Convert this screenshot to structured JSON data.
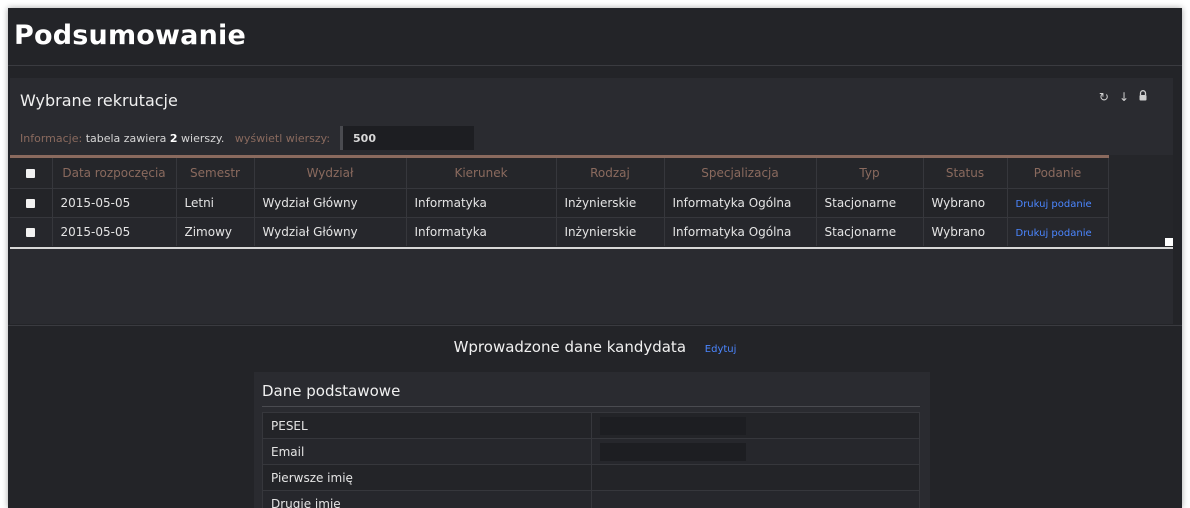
{
  "page": {
    "title": "Podsumowanie"
  },
  "recruitments": {
    "heading": "Wybrane rekrutacje",
    "toolbar_icons": [
      "refresh-icon",
      "download-icon",
      "lock-icon"
    ],
    "info": {
      "label": "Informacje:",
      "text_before": "tabela zawiera",
      "count": "2",
      "text_after": "wierszy.",
      "rows_label": "wyświetl wierszy:",
      "rows_value": "500"
    },
    "columns": [
      "Data rozpoczęcia",
      "Semestr",
      "Wydział",
      "Kierunek",
      "Rodzaj",
      "Specjalizacja",
      "Typ",
      "Status",
      "Podanie"
    ],
    "rows": [
      {
        "date": "2015-05-05",
        "semester": "Letni",
        "faculty": "Wydział Główny",
        "field": "Informatyka",
        "kind": "Inżynierskie",
        "specialization": "Informatyka Ogólna",
        "type": "Stacjonarne",
        "status": "Wybrano",
        "action": "Drukuj podanie"
      },
      {
        "date": "2015-05-05",
        "semester": "Zimowy",
        "faculty": "Wydział Główny",
        "field": "Informatyka",
        "kind": "Inżynierskie",
        "specialization": "Informatyka Ogólna",
        "type": "Stacjonarne",
        "status": "Wybrano",
        "action": "Drukuj podanie"
      }
    ]
  },
  "candidate": {
    "heading": "Wprowadzone dane kandydata",
    "edit_label": "Edytuj",
    "section_title": "Dane podstawowe",
    "fields": [
      {
        "label": "PESEL",
        "value": ""
      },
      {
        "label": "Email",
        "value": ""
      },
      {
        "label": "Pierwsze imię",
        "value": ""
      },
      {
        "label": "Drugie imię",
        "value": ""
      }
    ]
  },
  "colors": {
    "background": "#232428",
    "panel": "#2a2b30",
    "accent_brown": "#8a6a5e",
    "link_blue": "#4b86ff"
  }
}
